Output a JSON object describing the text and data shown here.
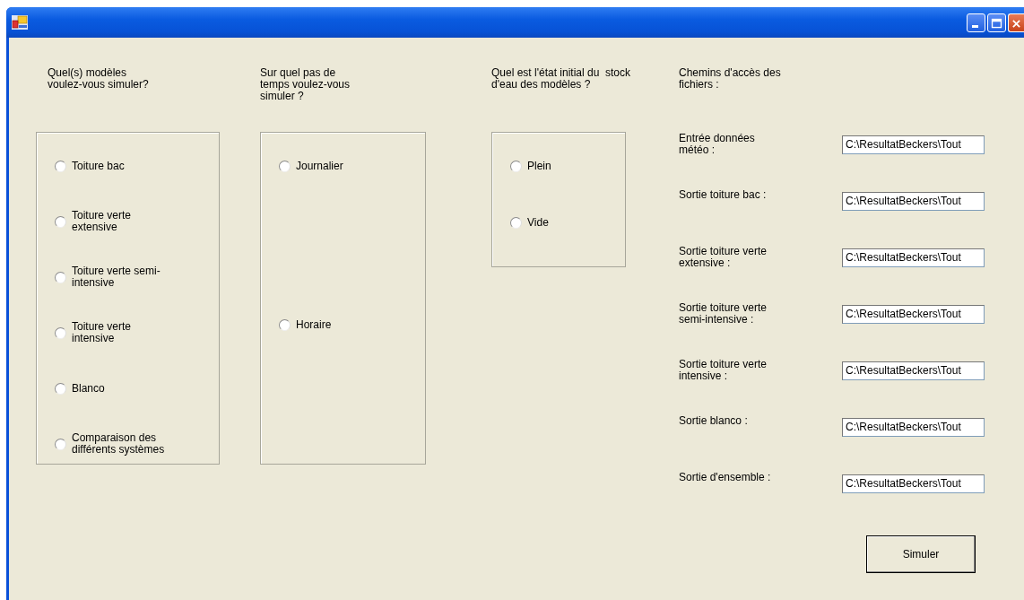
{
  "window": {
    "controls": [
      {
        "kind": "minimize"
      },
      {
        "kind": "maximize"
      },
      {
        "kind": "close"
      }
    ]
  },
  "groups": [
    {
      "question": "Quel(s) modèles\nvoulez-vous simuler?",
      "options": [
        {
          "label": "Toiture bac",
          "selected": false
        },
        {
          "label": "Toiture verte\nextensive",
          "selected": false
        },
        {
          "label": "Toiture verte semi-\nintensive",
          "selected": false
        },
        {
          "label": "Toiture verte\nintensive",
          "selected": false
        },
        {
          "label": "Blanco",
          "selected": false
        },
        {
          "label": "Comparaison des\ndifférents systèmes",
          "selected": false
        }
      ]
    },
    {
      "question": "Sur quel pas de\ntemps voulez-vous\nsimuler ?",
      "options": [
        {
          "label": "Journalier",
          "selected": false
        },
        {
          "label": "Horaire",
          "selected": false
        }
      ]
    },
    {
      "question": "Quel est l'état initial du  stock\nd'eau des modèles ?",
      "options": [
        {
          "label": "Plein",
          "selected": false
        },
        {
          "label": "Vide",
          "selected": false
        }
      ]
    }
  ],
  "paths": {
    "heading": "Chemins d'accès des\nfichiers :",
    "rows": [
      {
        "label": "Entrée données\nmétéo :",
        "value": "C:\\ResultatBeckers\\Tout"
      },
      {
        "label": "Sortie toiture bac :",
        "value": "C:\\ResultatBeckers\\Tout"
      },
      {
        "label": "Sortie toiture verte\nextensive :",
        "value": "C:\\ResultatBeckers\\Tout"
      },
      {
        "label": "Sortie toiture verte\nsemi-intensive :",
        "value": "C:\\ResultatBeckers\\Tout"
      },
      {
        "label": "Sortie toiture verte\nintensive :",
        "value": "C:\\ResultatBeckers\\Tout"
      },
      {
        "label": "Sortie blanco :",
        "value": "C:\\ResultatBeckers\\Tout"
      },
      {
        "label": "Sortie d'ensemble :",
        "value": "C:\\ResultatBeckers\\Tout"
      }
    ]
  },
  "button": "Simuler"
}
